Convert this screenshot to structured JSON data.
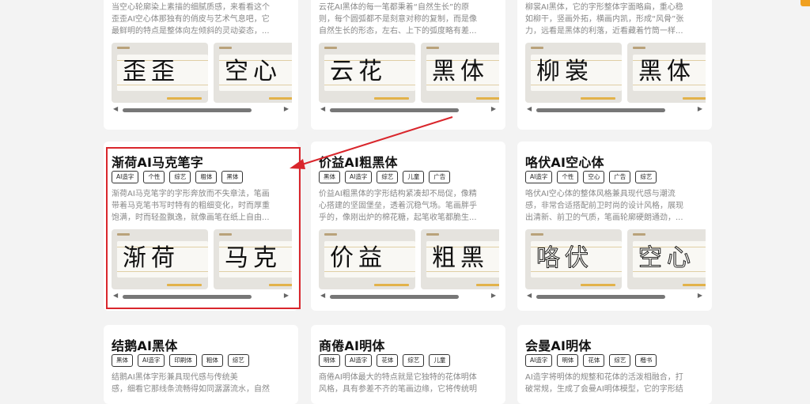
{
  "cards_top": [
    {
      "desc": "当空心轮廓染上素描的细腻质感，来看看这个歪歪AI空心体那独有的俏皮与艺术气息吧，它最鲜明的特点是整体向左倾斜的灵动姿态，",
      "lines": [
        "当空心轮廓染上素描的细腻质感，来看看这个",
        "歪歪AI空心体那独有的俏皮与艺术气息吧，它",
        "最鲜明的特点是整体向左倾斜的灵动姿态，..."
      ],
      "thumbs": [
        "歪歪",
        "空心"
      ]
    },
    {
      "lines": [
        "云花AI黑体的每一笔都秉着“自然生长”的原",
        "则，每个圆弧都不是刻意对称的复制，而是像",
        "自然生长的形态，左右、上下的弧度略有差..."
      ],
      "thumbs": [
        "云花",
        "黑体"
      ]
    },
    {
      "lines": [
        "柳裳AI黑体，它的字形整体字面略扁，重心稳",
        "如柳干，竖画外拓，横画内凯，形成“风骨”张",
        "力，远看是黑体的利落，近看藏着竹筒一样..."
      ],
      "thumbs": [
        "柳裳",
        "黑体"
      ]
    }
  ],
  "cards_mid": [
    {
      "title": "渐荷AI马克笔字",
      "tags": [
        "AI造字",
        "个性",
        "综艺",
        "粗体",
        "黑体"
      ],
      "lines": [
        "渐荷AI马克笔字的字形奔放而不失章法，笔画",
        "带着马克笔书写时特有的粗细变化，时而厚重",
        "饱满，时而轻盈飘逸，就像画笔在纸上自由..."
      ],
      "thumbs": [
        "渐荷",
        "马克"
      ]
    },
    {
      "title": "价益AI粗黑体",
      "tags": [
        "黑体",
        "AI造字",
        "综艺",
        "儿童",
        "广告"
      ],
      "lines": [
        "价益AI粗黑体的字形结构紧凑却不局促，像精",
        "心搭建的坚固堡垒，透着沉稳气场。笔画胖乎",
        "乎的，像刚出炉的棉花糖，起笔收笔都脆生..."
      ],
      "thumbs": [
        "价益",
        "粗黑"
      ]
    },
    {
      "title": "咯伏AI空心体",
      "tags": [
        "AI造字",
        "个性",
        "空心",
        "广告",
        "综艺"
      ],
      "lines": [
        "咯伏AI空心体的整体风格兼具现代感与潮流",
        "感，非常合适搭配前卫时尚的设计风格，展现",
        "出清新、前卫的气质，笔画轮廓硬朗通劲，..."
      ],
      "thumbs": [
        "咯伏",
        "空心"
      ]
    }
  ],
  "cards_bot": [
    {
      "title": "结鹅AI黑体",
      "tags": [
        "黑体",
        "AI造字",
        "印刷体",
        "粗体",
        "综艺"
      ],
      "lines": [
        "结鹅AI黑体字形兼具现代感与传统美",
        "感，细看它那线条流畅得如同潺潺流水，自然"
      ]
    },
    {
      "title": "商倦AI明体",
      "tags": [
        "明体",
        "AI造字",
        "花体",
        "综艺",
        "儿童"
      ],
      "lines": [
        "商倦AI明体最大的特点就是它独特的花体明体",
        "风格，具有参差不齐的笔画边缘，它将传统明"
      ]
    },
    {
      "title": "会曼AI明体",
      "tags": [
        "AI造字",
        "明体",
        "花体",
        "综艺",
        "楷书"
      ],
      "lines": [
        "AI造字将明体的规整和花体的活泼相融合，打",
        "破常规，生成了会曼AI明体模型，它的字形结"
      ]
    }
  ],
  "colors": {
    "highlight": "#d9262c",
    "background": "#f3f3f3"
  }
}
